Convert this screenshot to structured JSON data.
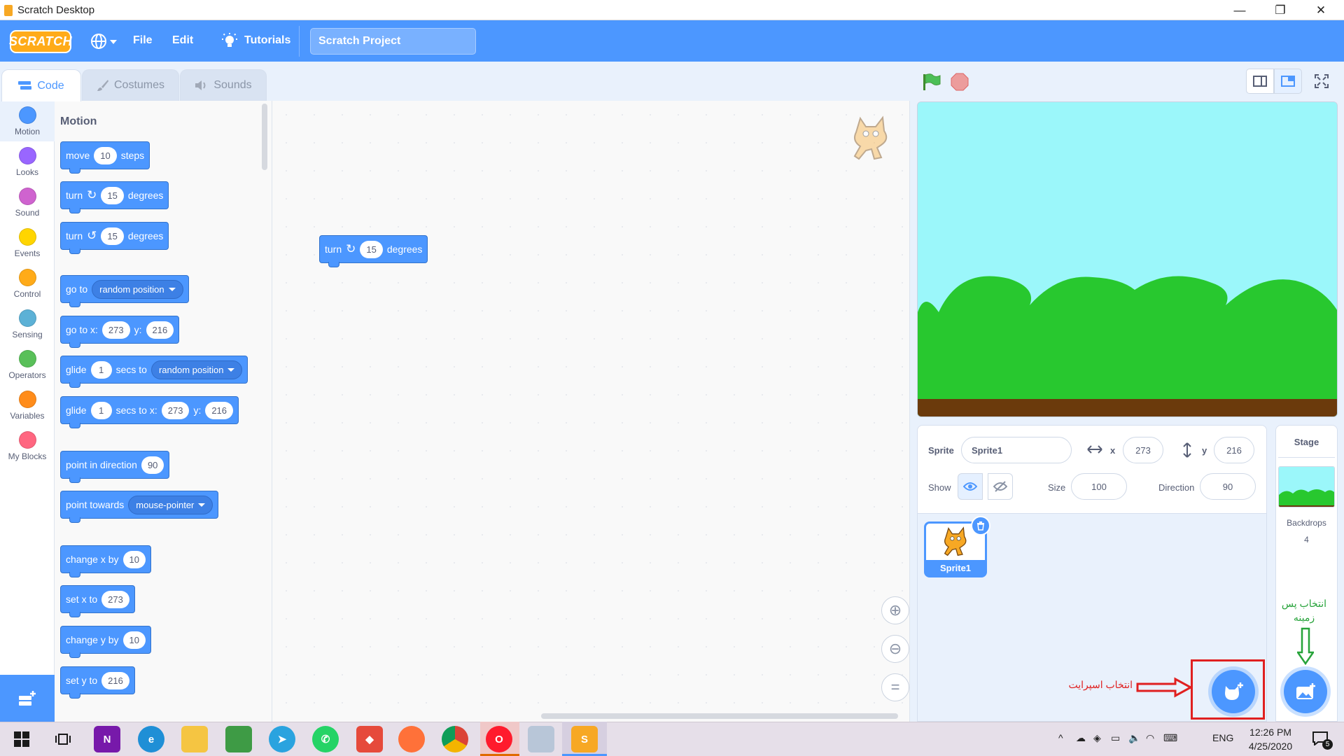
{
  "window": {
    "title": "Scratch Desktop",
    "min": "—",
    "max": "❐",
    "close": "✕"
  },
  "menubar": {
    "logo": "SCRATCH",
    "file": "File",
    "edit": "Edit",
    "tutorials": "Tutorials",
    "project_name": "Scratch Project"
  },
  "tabs": [
    {
      "label": "Code"
    },
    {
      "label": "Costumes"
    },
    {
      "label": "Sounds"
    }
  ],
  "categories": [
    {
      "label": "Motion",
      "color": "#4c97ff"
    },
    {
      "label": "Looks",
      "color": "#9966ff"
    },
    {
      "label": "Sound",
      "color": "#cf63cf"
    },
    {
      "label": "Events",
      "color": "#ffd500"
    },
    {
      "label": "Control",
      "color": "#ffab19"
    },
    {
      "label": "Sensing",
      "color": "#5cb1d6"
    },
    {
      "label": "Operators",
      "color": "#59c059"
    },
    {
      "label": "Variables",
      "color": "#ff8c1a"
    },
    {
      "label": "My Blocks",
      "color": "#ff6680"
    }
  ],
  "palette": {
    "heading": "Motion",
    "move": {
      "a": "move",
      "n": "10",
      "b": "steps"
    },
    "turn_cw": {
      "a": "turn",
      "n": "15",
      "b": "degrees"
    },
    "turn_ccw": {
      "a": "turn",
      "n": "15",
      "b": "degrees"
    },
    "goto": {
      "a": "go to",
      "dd": "random position"
    },
    "gotoxy": {
      "a": "go to x:",
      "x": "273",
      "b": "y:",
      "y": "216"
    },
    "glide_to": {
      "a": "glide",
      "n": "1",
      "b": "secs to",
      "dd": "random position"
    },
    "glide_xy": {
      "a": "glide",
      "n": "1",
      "b": "secs to x:",
      "x": "273",
      "c": "y:",
      "y": "216"
    },
    "point_dir": {
      "a": "point in direction",
      "n": "90"
    },
    "point_towards": {
      "a": "point towards",
      "dd": "mouse-pointer"
    },
    "change_x": {
      "a": "change x by",
      "n": "10"
    },
    "set_x": {
      "a": "set x to",
      "n": "273"
    },
    "change_y": {
      "a": "change y by",
      "n": "10"
    },
    "set_y": {
      "a": "set y to",
      "n": "216"
    }
  },
  "script_block": {
    "a": "turn",
    "n": "15",
    "b": "degrees"
  },
  "sprite_info": {
    "sprite_label": "Sprite",
    "sprite_name": "Sprite1",
    "x_label": "x",
    "x": "273",
    "y_label": "y",
    "y": "216",
    "show_label": "Show",
    "size_label": "Size",
    "size": "100",
    "direction_label": "Direction",
    "direction": "90"
  },
  "sprites": [
    {
      "name": "Sprite1"
    }
  ],
  "stage_pane": {
    "title": "Stage",
    "backdrops_label": "Backdrops",
    "backdrops_count": "4"
  },
  "annotations": {
    "backdrop_note": "انتخاب پس زمینه",
    "sprite_note": "انتخاب اسپرایت"
  },
  "taskbar": {
    "lang": "ENG",
    "time": "12:26 PM",
    "date": "4/25/2020",
    "notif_count": "5"
  },
  "colors": {
    "accent": "#4c97ff",
    "motion_block": "#4c97ff",
    "stage_sky": "#9bf7fa",
    "hill": "#28c82f",
    "ground": "#6b3a0c",
    "annotation_red": "#e02020",
    "annotation_green": "#27a33a"
  }
}
